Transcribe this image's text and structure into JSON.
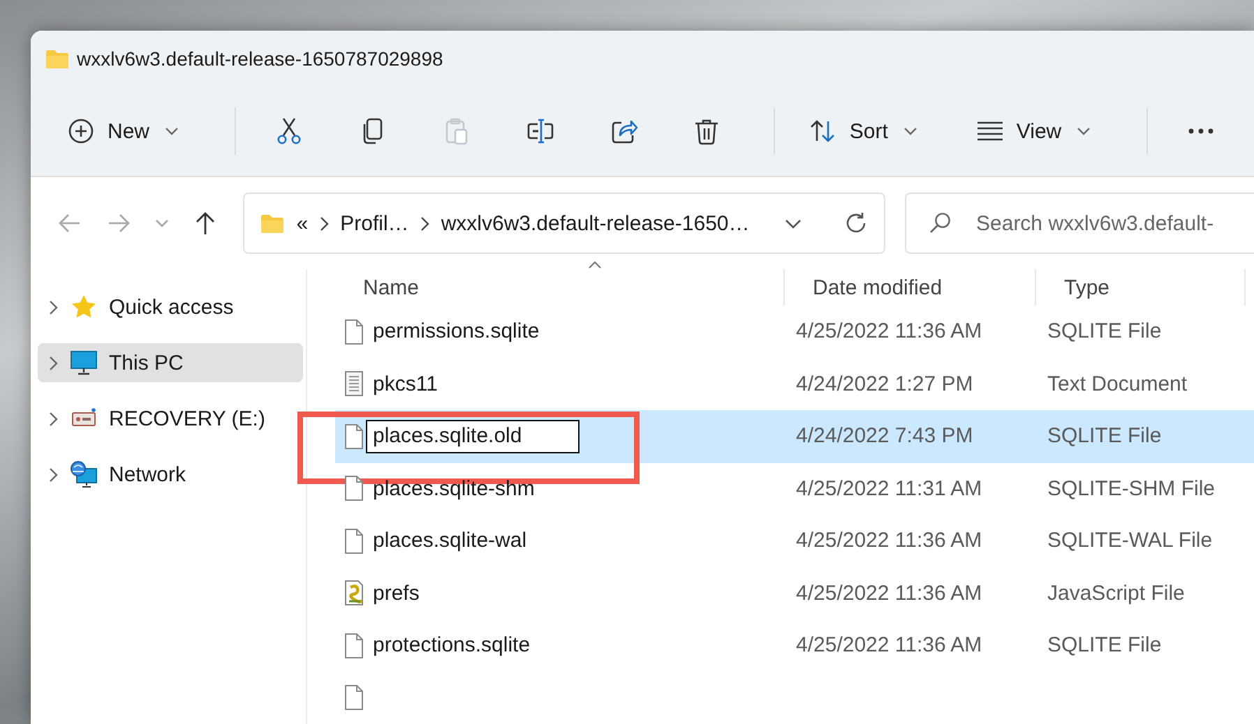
{
  "window": {
    "title": "wxxlv6w3.default-release-1650787029898"
  },
  "toolbar": {
    "items": [
      {
        "kind": "new",
        "label": "New",
        "disabled": false
      },
      {
        "kind": "cut",
        "disabled": false
      },
      {
        "kind": "copy",
        "disabled": false
      },
      {
        "kind": "paste",
        "disabled": true
      },
      {
        "kind": "rename",
        "disabled": false
      },
      {
        "kind": "share",
        "disabled": false
      },
      {
        "kind": "delete",
        "disabled": false
      },
      {
        "kind": "sort",
        "label": "Sort",
        "disabled": false
      },
      {
        "kind": "view",
        "label": "View",
        "disabled": false
      },
      {
        "kind": "more",
        "disabled": false
      }
    ]
  },
  "navigation": {
    "buttons": [
      {
        "kind": "back",
        "disabled": true
      },
      {
        "kind": "forward",
        "disabled": true
      },
      {
        "kind": "recent",
        "disabled": true
      },
      {
        "kind": "up",
        "disabled": false
      }
    ]
  },
  "address": {
    "overflow": "«",
    "segments": [
      "Profil…",
      "wxxlv6w3.default-release-1650…"
    ]
  },
  "search": {
    "placeholder": "Search wxxlv6w3.default-"
  },
  "sidebar": {
    "items": [
      {
        "kind": "star",
        "label": "Quick access",
        "selected": false
      },
      {
        "kind": "pc",
        "label": "This PC",
        "selected": true
      },
      {
        "kind": "drive",
        "label": "RECOVERY (E:)",
        "selected": false
      },
      {
        "kind": "network",
        "label": "Network",
        "selected": false
      }
    ]
  },
  "file_list": {
    "columns": [
      {
        "label": "Name",
        "sorted": true
      },
      {
        "label": "Date modified",
        "sorted": false
      },
      {
        "label": "Type",
        "sorted": false
      }
    ],
    "rows": [
      {
        "kind": "blank",
        "name": "permissions.sqlite",
        "date": "4/25/2022 11:36 AM",
        "type": "SQLITE File",
        "selected": false,
        "renaming": false,
        "highlighted": false
      },
      {
        "kind": "text",
        "name": "pkcs11",
        "date": "4/24/2022 1:27 PM",
        "type": "Text Document",
        "selected": false,
        "renaming": false,
        "highlighted": false
      },
      {
        "kind": "blank",
        "name": "places.sqlite.old",
        "date": "4/24/2022 7:43 PM",
        "type": "SQLITE File",
        "selected": true,
        "renaming": true,
        "highlighted": true
      },
      {
        "kind": "blank",
        "name": "places.sqlite-shm",
        "date": "4/25/2022 11:31 AM",
        "type": "SQLITE-SHM File",
        "selected": false,
        "renaming": false,
        "highlighted": false
      },
      {
        "kind": "blank",
        "name": "places.sqlite-wal",
        "date": "4/25/2022 11:36 AM",
        "type": "SQLITE-WAL File",
        "selected": false,
        "renaming": false,
        "highlighted": false
      },
      {
        "kind": "script",
        "name": "prefs",
        "date": "4/25/2022 11:36 AM",
        "type": "JavaScript File",
        "selected": false,
        "renaming": false,
        "highlighted": false
      },
      {
        "kind": "blank",
        "name": "protections.sqlite",
        "date": "4/25/2022 11:36 AM",
        "type": "SQLITE File",
        "selected": false,
        "renaming": false,
        "highlighted": false
      }
    ],
    "more_rows_below": true
  }
}
